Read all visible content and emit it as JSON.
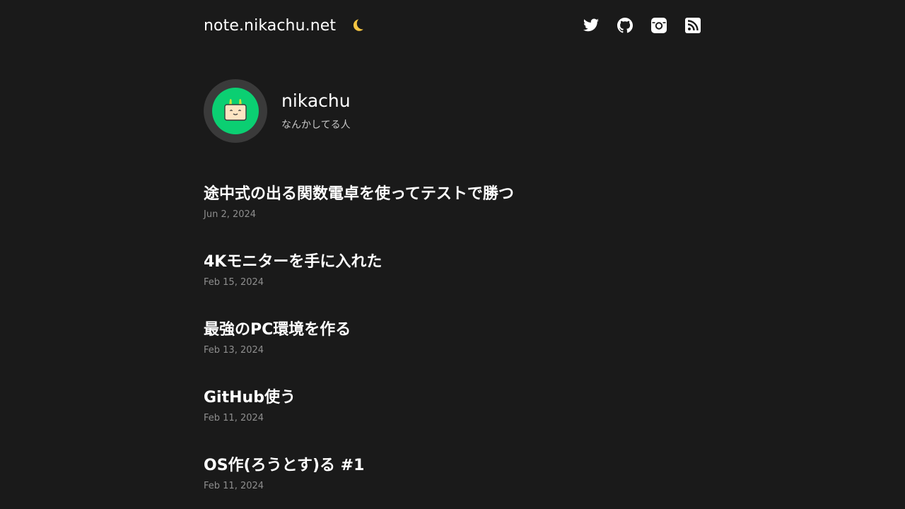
{
  "header": {
    "site_title": "note.nikachu.net",
    "theme_icon": "moon-icon",
    "social": [
      {
        "name": "twitter-icon"
      },
      {
        "name": "github-icon"
      },
      {
        "name": "instagram-icon"
      },
      {
        "name": "rss-icon"
      }
    ]
  },
  "profile": {
    "name": "nikachu",
    "bio": "なんかしてる人"
  },
  "posts": [
    {
      "title": "途中式の出る関数電卓を使ってテストで勝つ",
      "date": "Jun 2, 2024"
    },
    {
      "title": "4Kモニターを手に入れた",
      "date": "Feb 15, 2024"
    },
    {
      "title": "最強のPC環境を作る",
      "date": "Feb 13, 2024"
    },
    {
      "title": "GitHub使う",
      "date": "Feb 11, 2024"
    },
    {
      "title": "OS作(ろうとす)る #1",
      "date": "Feb 11, 2024"
    }
  ],
  "colors": {
    "background": "#1a1a1a",
    "avatar_green": "#0bcf72",
    "moon": "#f5c542"
  }
}
